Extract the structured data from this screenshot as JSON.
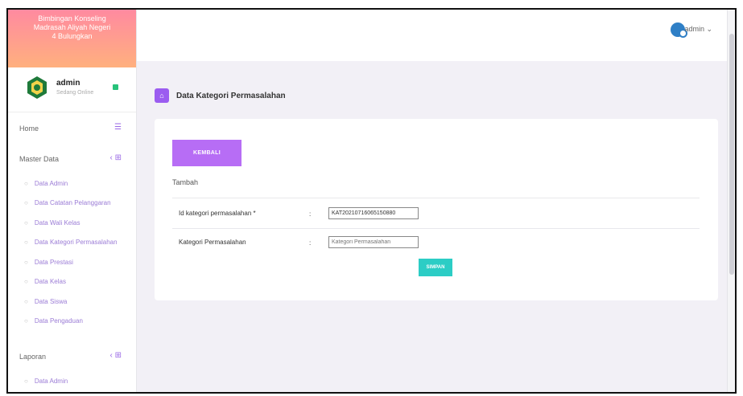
{
  "brand": {
    "line1": "Bimbingan Konseling",
    "line2": "Madrasah Aliyah Negeri",
    "line3": "4 Bulungkan"
  },
  "user": {
    "name": "admin",
    "status": "Sedang Online"
  },
  "sidebar": {
    "home_label": "Home",
    "master_label": "Master Data",
    "master_items": [
      "Data Admin",
      "Data Catatan Pelanggaran",
      "Data Wali Kelas",
      "Data Kategori Permasalahan",
      "Data Prestasi",
      "Data Kelas",
      "Data Siswa",
      "Data Pengaduan"
    ],
    "laporan_label": "Laporan",
    "laporan_items": [
      "Data Admin"
    ]
  },
  "topbar": {
    "user_label": "admin ⌄"
  },
  "page": {
    "title": "Data Kategori Permasalahan",
    "back_button": "KEMBALI",
    "subtitle": "Tambah",
    "field1_label": "Id kategori permasalahan *",
    "field1_value": "KAT20210716065150880",
    "field2_label": "Kategori Permasalahan",
    "field2_placeholder": "Kategori Permasalahan",
    "colon": ":",
    "save_button": "SIMPAN"
  },
  "colors": {
    "brand_gradient_top": "#ff8aa0",
    "brand_gradient_bottom": "#ffb07e",
    "accent_purple": "#b76df5",
    "save_teal": "#2ccdc5",
    "online_green": "#27c27a"
  }
}
